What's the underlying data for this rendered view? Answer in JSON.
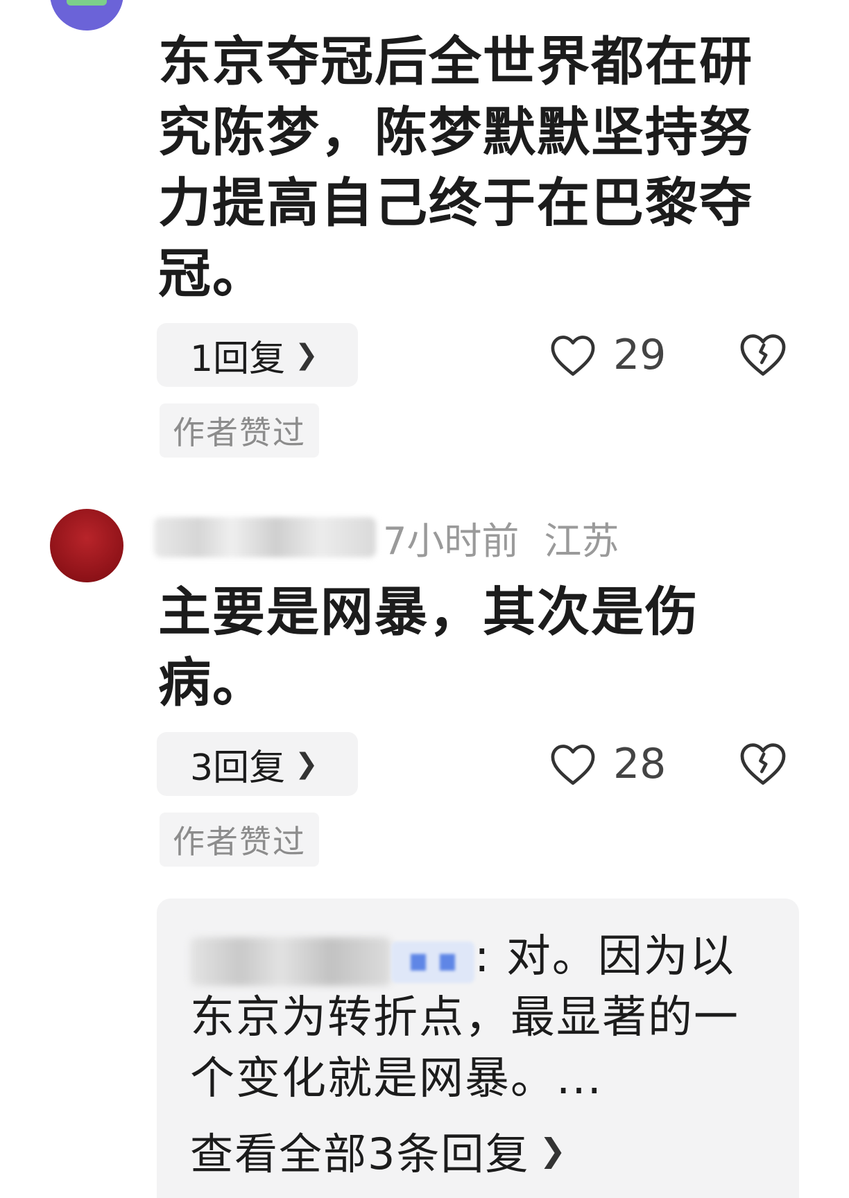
{
  "comments": [
    {
      "text": "东京夺冠后全世界都在研究陈梦，陈梦默默坚持努力提高自己终于在巴黎夺冠。",
      "reply_label": "1回复",
      "likes": "29",
      "author_liked": "作者赞过"
    },
    {
      "time": "7小时前",
      "location": "江苏",
      "text": "主要是网暴，其次是伤病。",
      "reply_label": "3回复",
      "likes": "28",
      "author_liked": "作者赞过",
      "reply_preview": {
        "text": ": 对。因为以东京为转折点，最显著的一个变化就是网暴。...",
        "view_all": "查看全部3条回复"
      }
    }
  ],
  "icons": {
    "like": "heart-outline-icon",
    "dislike": "broken-heart-icon",
    "chevron": "chevron-right-icon"
  },
  "colors": {
    "text": "#1c1c1c",
    "muted": "#9a9a9a",
    "chip_bg": "#f3f3f4"
  }
}
